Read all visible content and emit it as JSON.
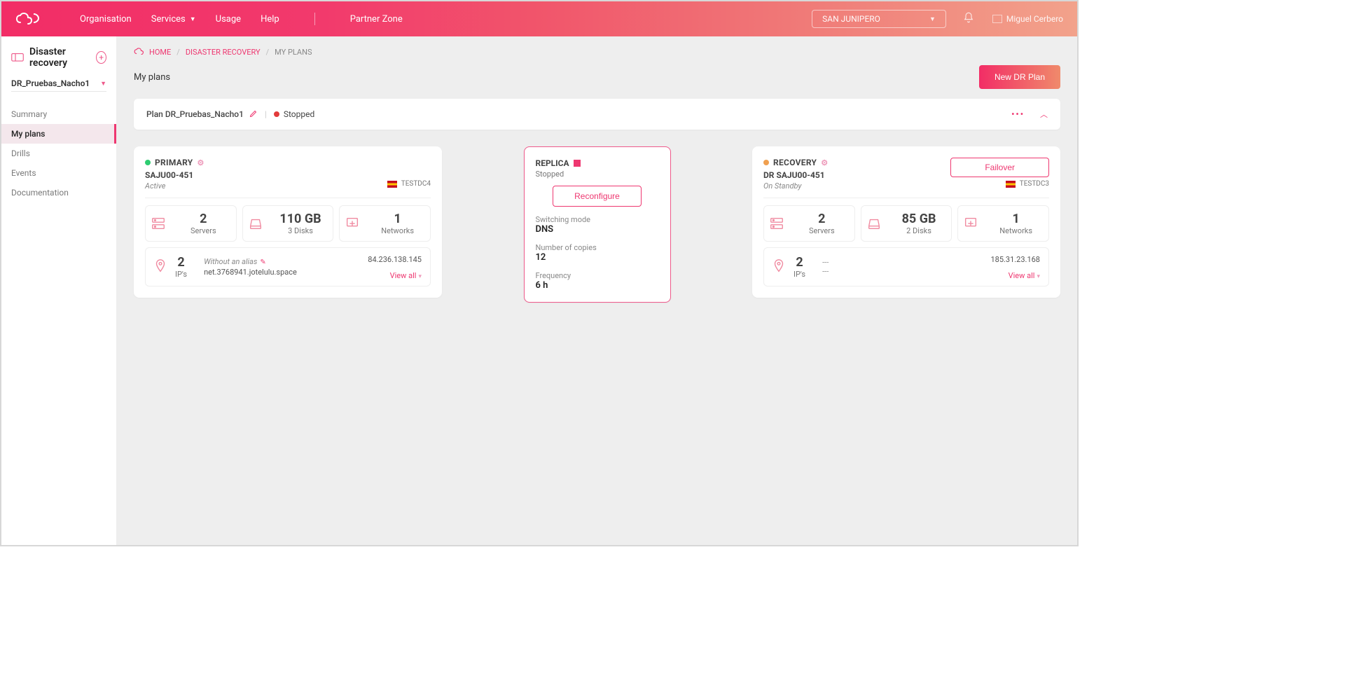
{
  "topnav": {
    "organisation": "Organisation",
    "services": "Services",
    "usage": "Usage",
    "help": "Help",
    "partner": "Partner Zone"
  },
  "org_selector": "SAN JUNIPERO",
  "user_name": "Miguel Cerbero",
  "sidebar": {
    "title": "Disaster recovery",
    "selected_plan": "DR_Pruebas_Nacho1",
    "items": [
      "Summary",
      "My plans",
      "Drills",
      "Events",
      "Documentation"
    ],
    "active_index": 1
  },
  "breadcrumb": {
    "home": "HOME",
    "section": "DISASTER RECOVERY",
    "current": "MY PLANS"
  },
  "page_title": "My plans",
  "btn_new": "New DR Plan",
  "plan_bar": {
    "name": "Plan DR_Pruebas_Nacho1",
    "status": "Stopped"
  },
  "primary": {
    "title": "PRIMARY",
    "server": "SAJU00-451",
    "state": "Active",
    "dc": "TESTDC4",
    "servers_count": "2",
    "servers_label": "Servers",
    "storage_value": "110 GB",
    "storage_sub": "3 Disks",
    "networks_count": "1",
    "networks_label": "Networks",
    "ips_count": "2",
    "ips_label": "IP's",
    "alias_label": "Without an alias",
    "addr": "net.3768941.jotelulu.space",
    "ip": "84.236.138.145",
    "viewall": "View all"
  },
  "replica": {
    "title": "REPLICA",
    "status": "Stopped",
    "btn": "Reconfigure",
    "switch_label": "Switching mode",
    "switch_value": "DNS",
    "copies_label": "Number of copies",
    "copies_value": "12",
    "freq_label": "Frequency",
    "freq_value": "6 h"
  },
  "recovery": {
    "title": "RECOVERY",
    "server": "DR SAJU00-451",
    "state": "On Standby",
    "dc": "TESTDC3",
    "btn": "Failover",
    "servers_count": "2",
    "servers_label": "Servers",
    "storage_value": "85 GB",
    "storage_sub": "2 Disks",
    "networks_count": "1",
    "networks_label": "Networks",
    "ips_count": "2",
    "ips_label": "IP's",
    "ip": "185.31.23.168",
    "viewall": "View all"
  }
}
